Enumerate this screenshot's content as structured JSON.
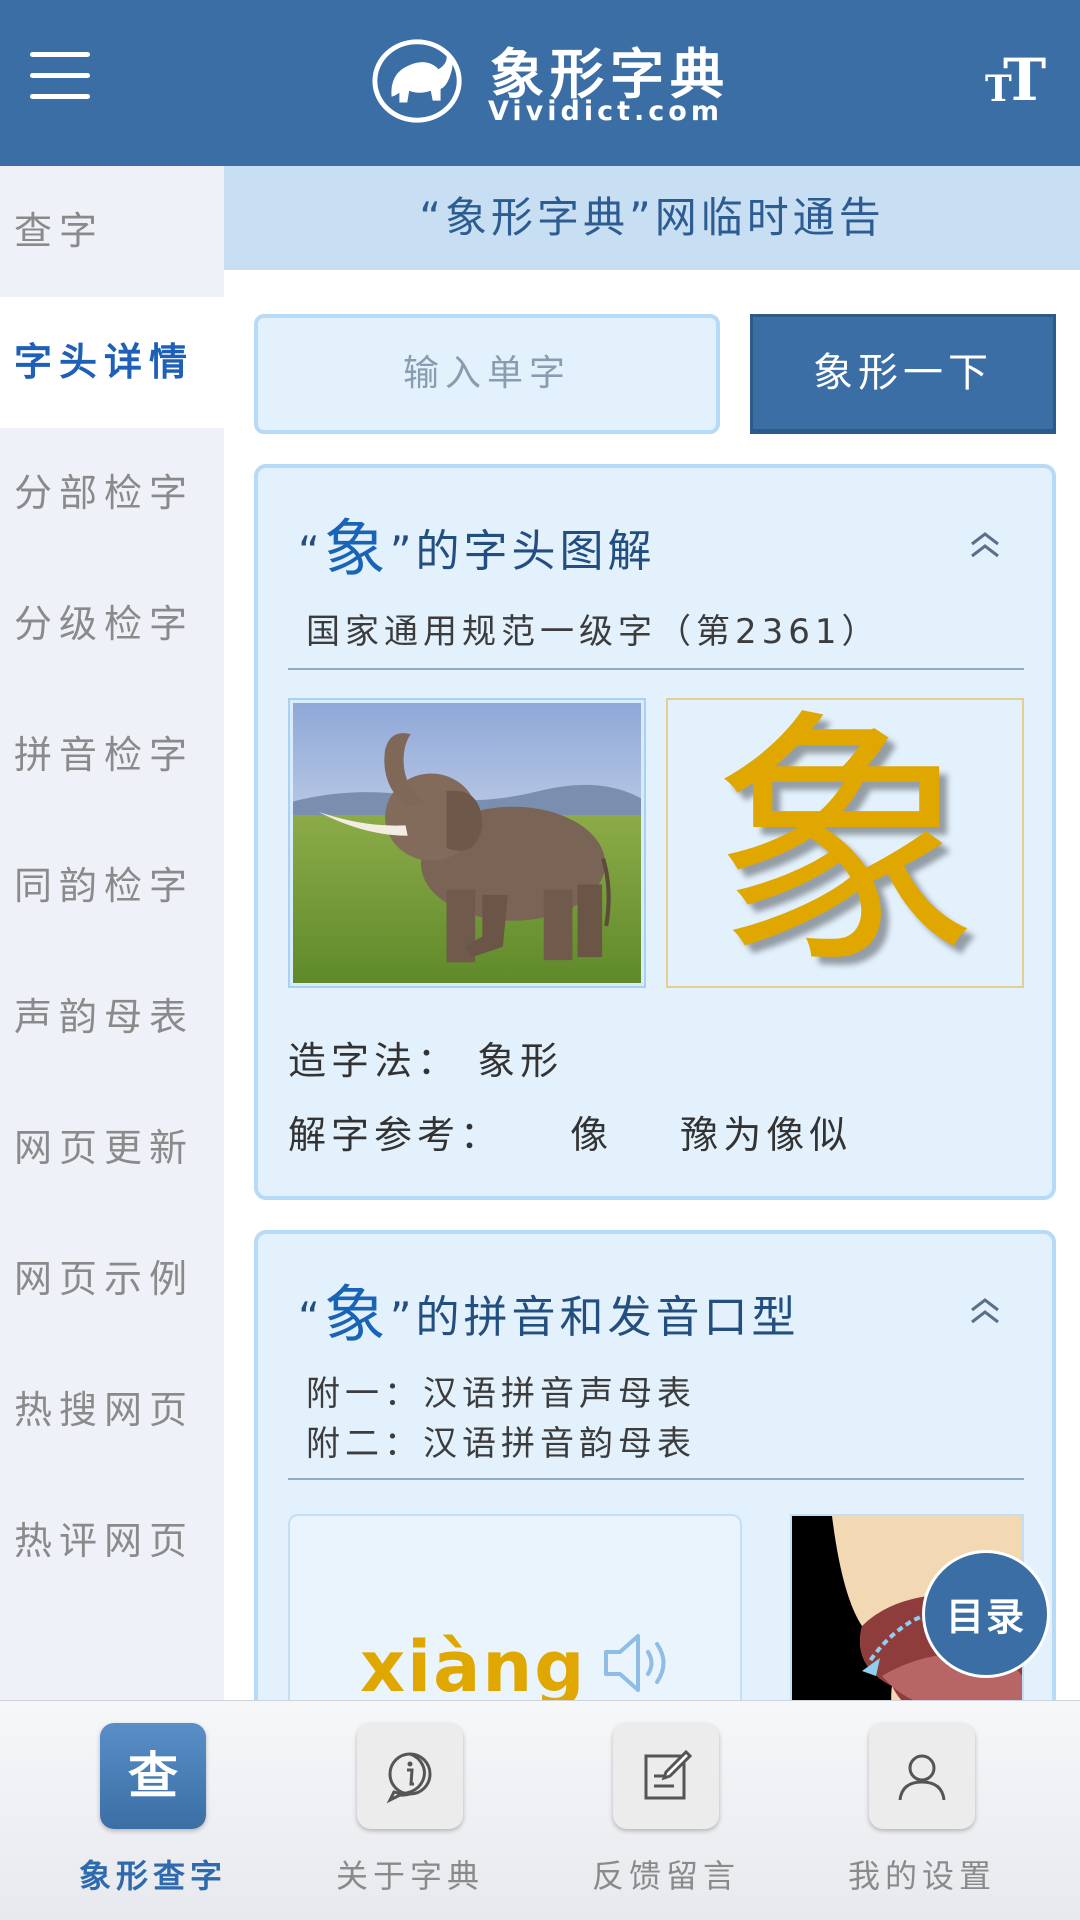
{
  "header": {
    "logo_title": "象形字典",
    "logo_subtitle": "Vividict.com",
    "font_size_icon": "tT"
  },
  "sidebar": {
    "items": [
      {
        "label": "查字",
        "active": false
      },
      {
        "label": "字头详情",
        "active": true
      },
      {
        "label": "分部检字",
        "active": false
      },
      {
        "label": "分级检字",
        "active": false
      },
      {
        "label": "拼音检字",
        "active": false
      },
      {
        "label": "同韵检字",
        "active": false
      },
      {
        "label": "声韵母表",
        "active": false
      },
      {
        "label": "网页更新",
        "active": false
      },
      {
        "label": "网页示例",
        "active": false
      },
      {
        "label": "热搜网页",
        "active": false
      },
      {
        "label": "热评网页",
        "active": false
      }
    ]
  },
  "main": {
    "notice": "“象形字典”网临时通告",
    "search": {
      "placeholder": "输入单字",
      "button_label": "象形一下"
    },
    "card1": {
      "quote_open": "“",
      "char": "象",
      "quote_close": "”",
      "title_suffix": "的字头图解",
      "level_line": "国家通用规范一级字（第2361）",
      "glyph": "象",
      "formation_label": "造字法：",
      "formation_value": "象形",
      "reference_label": "解字参考：",
      "references": [
        "像",
        "豫为像似"
      ]
    },
    "card2": {
      "quote_open": "“",
      "char": "象",
      "quote_close": "”",
      "title_suffix": "的拼音和发音口型",
      "appendix1": "附一：汉语拼音声母表",
      "appendix2": "附二：汉语拼音韵母表",
      "pinyin": "xiàng"
    }
  },
  "toc_button": "目录",
  "tabbar": {
    "tabs": [
      {
        "label": "象形查字",
        "icon_text": "查",
        "active": true
      },
      {
        "label": "关于字典",
        "active": false
      },
      {
        "label": "反馈留言",
        "active": false
      },
      {
        "label": "我的设置",
        "active": false
      }
    ]
  },
  "colors": {
    "header_blue": "#3a6ea5",
    "active_blue": "#1e5fb8",
    "glyph_gold": "#e0a700",
    "card_bg": "#e3f1fd"
  }
}
